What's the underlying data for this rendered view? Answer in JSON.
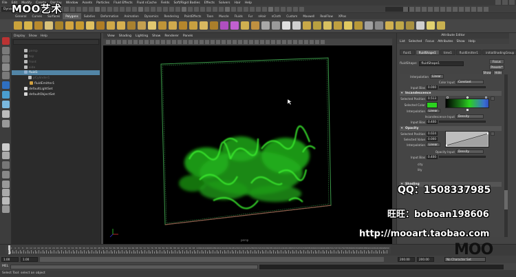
{
  "menubar": {
    "items": [
      "File",
      "Edit",
      "Modify",
      "Create",
      "Display",
      "Window",
      "Assets",
      "Particles",
      "Fluid Effects",
      "Fluid nCache",
      "Fields",
      "Soft/Rigid Bodies",
      "Effects",
      "Solvers",
      "Hair",
      "Help"
    ]
  },
  "status": {
    "mode": "Dynamics"
  },
  "shelf": {
    "tabs": [
      "General",
      "Curves",
      "Surfaces",
      "Polygons",
      "Subdivs",
      "Deformation",
      "Animation",
      "Dynamics",
      "Rendering",
      "PaintEffects",
      "Toon",
      "Muscle",
      "Fluids",
      "Fur",
      "nHair",
      "nCloth",
      "Custom",
      "Maxwell",
      "RealFlow",
      "XPlos"
    ],
    "active_tab": "Polygons"
  },
  "logo": {
    "text": "MOO艺术"
  },
  "outliner": {
    "menu": [
      "Display",
      "Show",
      "Help"
    ],
    "rows": [
      {
        "label": "persp",
        "dim": true
      },
      {
        "label": "top",
        "dim": true
      },
      {
        "label": "front",
        "dim": true
      },
      {
        "label": "side",
        "dim": true
      },
      {
        "label": "fluid1",
        "selected": true
      },
      {
        "label": "pCylinder1",
        "dim": true
      },
      {
        "label": "fluidEmitter1"
      },
      {
        "label": "defaultLightSet"
      },
      {
        "label": "defaultObjectSet"
      }
    ]
  },
  "viewport": {
    "menu": [
      "View",
      "Shading",
      "Lighting",
      "Show",
      "Renderer",
      "Panels"
    ],
    "camera": "persp"
  },
  "attribute_editor": {
    "title": "Attribute Editor",
    "menu": [
      "List",
      "Selected",
      "Focus",
      "Attributes",
      "Show",
      "Help"
    ],
    "tabs": [
      "fluid1",
      "fluidShape1",
      "time1",
      "fluidEmitter1",
      "initialShadingGroup"
    ],
    "active_tab": "fluidShape1",
    "name_label": "fluidShape:",
    "name_value": "fluidShape1",
    "focus_btn": "Focus",
    "presets_btn": "Presets*",
    "show_btn": "Show",
    "hide_btn": "Hide",
    "interp_top_label": "Interpolation",
    "interp_top_value": "Linear",
    "color_input_label": "Color Input",
    "color_input_value": "Constant",
    "input_bias_label": "Input Bias",
    "input_bias_top": "0.000",
    "incandescence": {
      "title": "Incandescence",
      "selected_position_label": "Selected Position",
      "selected_position": "0.513",
      "selected_color_label": "Selected Color",
      "interpolation_label": "Interpolation",
      "interpolation": "Linear",
      "incand_input_label": "Incandescence Input",
      "incand_input": "Density",
      "input_bias_label": "Input Bias",
      "input_bias": "0.400"
    },
    "opacity": {
      "title": "Opacity",
      "selected_position_label": "Selected Position",
      "selected_position": "0.024",
      "selected_value_label": "Selected Value",
      "selected_value": "0.000",
      "interpolation_label": "Interpolation",
      "interpolation": "Linear",
      "opacity_input_label": "Opacity Input",
      "opacity_input": "Density",
      "input_bias_label": "Input Bias",
      "input_bias": "0.400"
    },
    "partial_labels": [
      "city",
      "lity",
      "Shading"
    ]
  },
  "timeline": {
    "ticks": [
      "2",
      "4",
      "6",
      "8",
      "10",
      "12",
      "14",
      "16",
      "18",
      "20",
      "22",
      "24",
      "26",
      "28",
      "30",
      "32",
      "34",
      "36",
      "38",
      "40",
      "42",
      "44",
      "46",
      "48",
      "50",
      "52",
      "54",
      "56",
      "58",
      "60",
      "62",
      "64",
      "66",
      "68",
      "70",
      "72",
      "74",
      "76",
      "78",
      "80",
      "82",
      "84",
      "86",
      "88",
      "90",
      "92",
      "94",
      "96",
      "98",
      "100",
      "102",
      "104",
      "106",
      "108",
      "110",
      "112",
      "114",
      "116",
      "118",
      "120",
      "122",
      "124",
      "126",
      "128",
      "130",
      "132",
      "134",
      "136",
      "138",
      "140",
      "142",
      "144",
      "146",
      "148",
      "150",
      "152",
      "154",
      "156",
      "158",
      "160",
      "162",
      "164",
      "166",
      "168",
      "170",
      "172",
      "174",
      "176",
      "178",
      "180",
      "182",
      "184",
      "186",
      "188",
      "190",
      "192",
      "194",
      "196",
      "198",
      "200"
    ],
    "range_start": "1.00",
    "range_inner_start": "1.00",
    "range_end": "200.00",
    "range_inner_end": "200.00",
    "character_set": "No Character Set"
  },
  "cmdline": {
    "label": "MEL"
  },
  "helpline": {
    "text": "Select Tool: select an object"
  },
  "watermarks": {
    "qq": "QQ：1508337985",
    "wangwang": "旺旺：boboan198606",
    "url": "http://mooart.taobao.com",
    "brand": "MOO"
  },
  "colors": {
    "fluid": "#2bd21e",
    "selection": "#5285a6",
    "bounding_box": "#3c9b4a",
    "bbox_bottom": "#8b5a4a"
  }
}
